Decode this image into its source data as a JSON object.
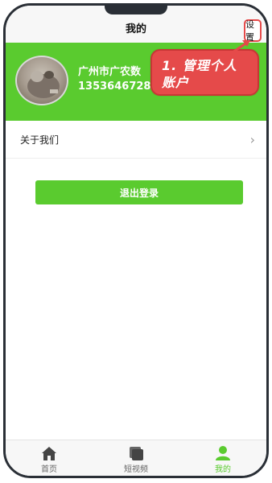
{
  "header": {
    "title": "我的",
    "settings_label": "设置"
  },
  "profile": {
    "name": "广州市广农数",
    "phone": "13536467284"
  },
  "tooltip": {
    "text": "1. 管理个人账户"
  },
  "menu": {
    "items": [
      {
        "label": "关于我们"
      }
    ]
  },
  "actions": {
    "logout_label": "退出登录"
  },
  "tabbar": {
    "tabs": [
      {
        "label": "首页",
        "icon": "home-icon"
      },
      {
        "label": "短视频",
        "icon": "video-icon"
      },
      {
        "label": "我的",
        "icon": "user-icon",
        "active": true
      }
    ]
  },
  "colors": {
    "accent": "#5acb2f",
    "tooltip": "#e54a4a",
    "frame": "#2a2f36"
  }
}
